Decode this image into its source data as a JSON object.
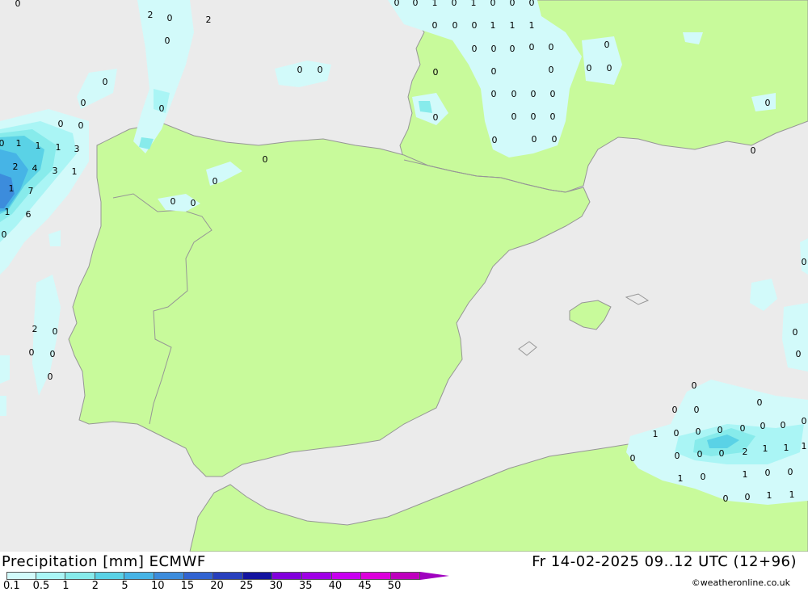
{
  "header": {
    "title": "Precipitation [mm] ECMWF",
    "time_info": "Fr 14-02-2025 09..12 UTC (12+96)",
    "credit": "©weatheronline.co.uk"
  },
  "legend": {
    "ticks": [
      "0.1",
      "0.5",
      "1",
      "2",
      "5",
      "10",
      "15",
      "20",
      "25",
      "30",
      "35",
      "40",
      "45",
      "50"
    ],
    "colors": [
      "#d2fafa",
      "#aaf5f5",
      "#87ebeb",
      "#5ad2e6",
      "#46b4e6",
      "#3c8cdc",
      "#3264d2",
      "#2840be",
      "#1414a0",
      "#8200dc",
      "#a000e6",
      "#c800f0",
      "#dc00dc",
      "#be00be"
    ],
    "arrow_color": "#a000c0"
  },
  "map": {
    "sea_color": "#ebebeb",
    "land_color": "#c8fa9b",
    "border_color": "#969696",
    "value_labels": [
      "0",
      "2",
      "0",
      "2",
      "0",
      "0",
      "0",
      "0",
      "0",
      "0",
      "0",
      "1",
      "1",
      "1",
      "3",
      "2",
      "4",
      "3",
      "1",
      "1",
      "7",
      "1",
      "6",
      "0",
      "2",
      "0",
      "0",
      "0",
      "0",
      "0",
      "0",
      "0",
      "0",
      "0",
      "0",
      "0",
      "0",
      "1",
      "0",
      "1",
      "0",
      "0",
      "0",
      "0",
      "0",
      "0",
      "1",
      "1",
      "1",
      "0",
      "0",
      "0",
      "0",
      "0",
      "0",
      "0",
      "0",
      "0",
      "0",
      "0",
      "0",
      "0",
      "0",
      "0",
      "0",
      "0",
      "0",
      "0",
      "0",
      "0",
      "0",
      "0",
      "0",
      "0",
      "0",
      "0",
      "0",
      "0",
      "0",
      "0",
      "0",
      "0",
      "0",
      "0",
      "0",
      "0",
      "0",
      "1",
      "0",
      "0",
      "0",
      "0",
      "2",
      "1",
      "1",
      "1",
      "1",
      "0",
      "0",
      "1",
      "0",
      "0",
      "0",
      "1",
      "1",
      "0",
      "0",
      "0",
      "0",
      "0"
    ]
  }
}
